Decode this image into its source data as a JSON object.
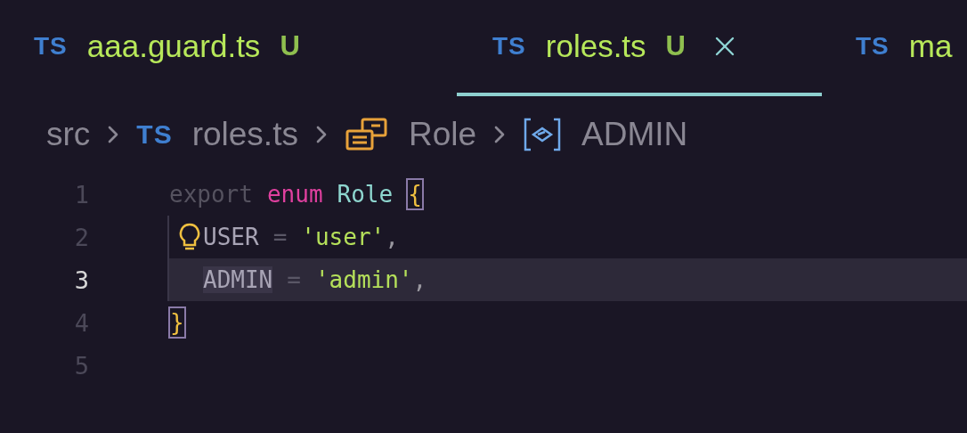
{
  "tabs": [
    {
      "icon": "TS",
      "label": "aaa.guard.ts",
      "badge": "U",
      "selected": false,
      "closable": false
    },
    {
      "icon": "TS",
      "label": "roles.ts",
      "badge": "U",
      "selected": true,
      "closable": true
    },
    {
      "icon": "TS",
      "label": "ma",
      "selected": false,
      "closable": false
    }
  ],
  "breadcrumb": [
    {
      "kind": "folder",
      "label": "src"
    },
    {
      "kind": "file",
      "icon": "TS",
      "label": "roles.ts"
    },
    {
      "kind": "enum",
      "label": "Role"
    },
    {
      "kind": "member",
      "label": "ADMIN"
    }
  ],
  "lines": [
    {
      "number": "1",
      "current": false,
      "indented": false,
      "lightbulb": false,
      "tokens": [
        {
          "kind": "muted",
          "text": "export"
        },
        {
          "kind": "keyword",
          "text": "enum"
        },
        {
          "kind": "type",
          "text": "Role"
        },
        {
          "kind": "bracket",
          "text": "{",
          "matched": true
        }
      ]
    },
    {
      "number": "2",
      "current": false,
      "indented": true,
      "lightbulb": true,
      "tokens": [
        {
          "kind": "ident",
          "text": "USER"
        },
        {
          "kind": "operator",
          "text": "="
        },
        {
          "kind": "string",
          "text": "'user'"
        },
        {
          "kind": "punct",
          "text": ",",
          "attached": true
        }
      ]
    },
    {
      "number": "3",
      "current": true,
      "indented": true,
      "lightbulb": false,
      "tokens": [
        {
          "kind": "ident",
          "text": "ADMIN",
          "highlighted": true
        },
        {
          "kind": "operator",
          "text": "="
        },
        {
          "kind": "string",
          "text": "'admin'"
        },
        {
          "kind": "punct",
          "text": ",",
          "attached": true
        }
      ]
    },
    {
      "number": "4",
      "current": false,
      "indented": false,
      "lightbulb": false,
      "tokens": [
        {
          "kind": "bracket",
          "text": "}",
          "matched": true
        }
      ]
    },
    {
      "number": "5",
      "current": false,
      "indented": false,
      "lightbulb": false
    }
  ]
}
